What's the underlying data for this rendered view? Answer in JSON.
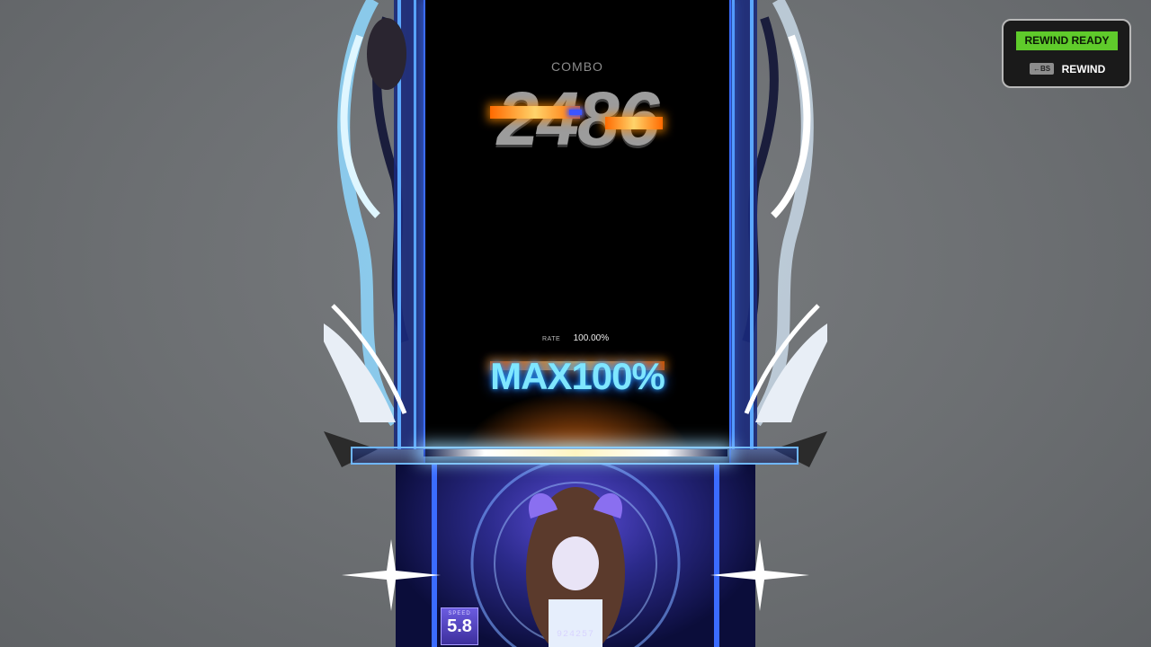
{
  "hud": {
    "combo_label": "COMBO",
    "combo_value": "2486",
    "rate_label": "RATE",
    "rate_value": "100.00%",
    "judgment_text": "MAX100%",
    "speed_label": "SPEED",
    "speed_value": "5.8",
    "score_value": "924257"
  },
  "rewind": {
    "status": "REWIND READY",
    "key_hint": "←BS",
    "action_label": "REWIND"
  },
  "colors": {
    "highway_border": "#3b6cff",
    "rewind_ready_bg": "#5fcb2b",
    "judgment_glow": "#7fe6ff",
    "combo_flash": "#ff8a00"
  },
  "icons": [
    "sparkle-icon",
    "backspace-key-icon"
  ]
}
